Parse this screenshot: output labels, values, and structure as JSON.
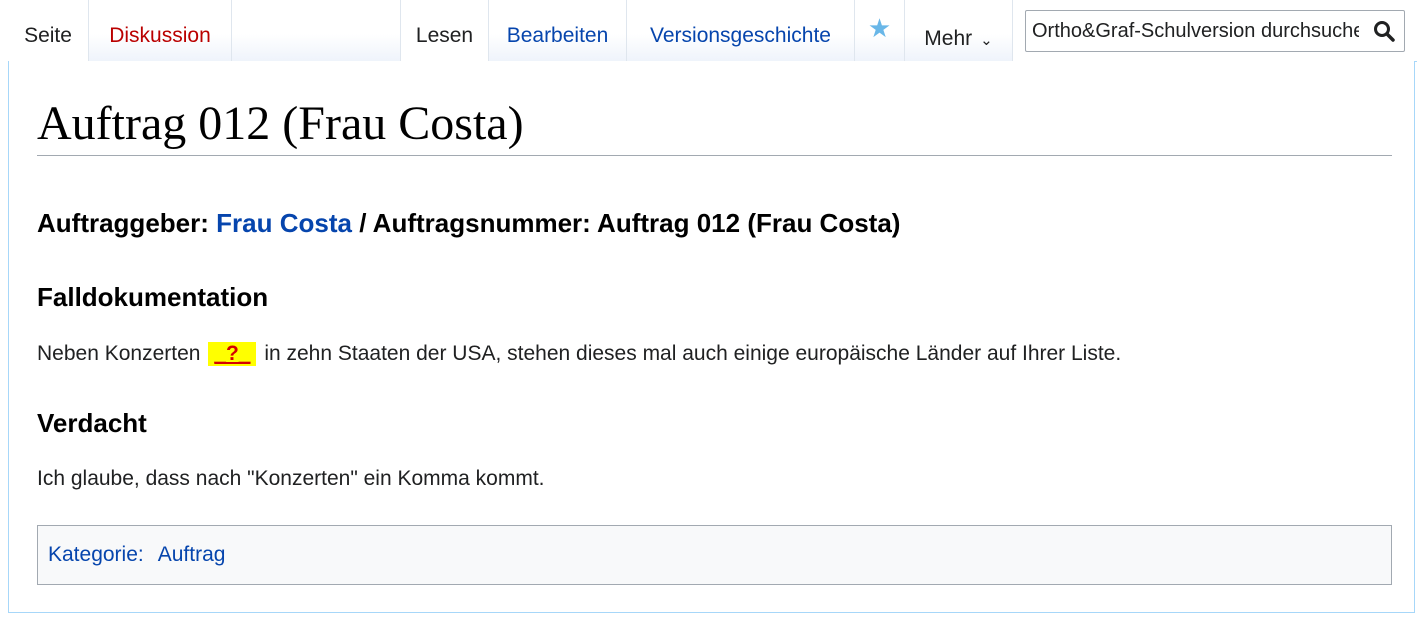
{
  "tabs": {
    "page": "Seite",
    "discussion": "Diskussion",
    "read": "Lesen",
    "edit": "Bearbeiten",
    "history": "Versionsgeschichte",
    "more": "Mehr",
    "watch_icon": "star-icon"
  },
  "search": {
    "placeholder": "Ortho&Graf-Schulversion durchsuchen",
    "icon": "search-icon"
  },
  "page": {
    "title": "Auftrag 012 (Frau Costa)",
    "client_label": "Auftraggeber:",
    "client_name": "Frau Costa",
    "order_label": "/ Auftragsnummer: Auftrag 012 (Frau Costa)"
  },
  "sections": {
    "documentation_heading": "Falldokumentation",
    "documentation_before": "Neben Konzerten",
    "documentation_blank": "_?_",
    "documentation_after": "in zehn Staaten der USA, stehen dieses mal auch einige europäische Länder auf Ihrer Liste.",
    "suspicion_heading": "Verdacht",
    "suspicion_text": "Ich glaube, dass nach \"Konzerten\" ein Komma kommt."
  },
  "categories": {
    "label": "Kategorie:",
    "items": [
      "Auftrag"
    ]
  },
  "colors": {
    "link": "#0645ad",
    "redlink": "#ba0000",
    "highlight": "#ffff00",
    "blank_text": "#d40000",
    "border": "#a7d7f9"
  }
}
